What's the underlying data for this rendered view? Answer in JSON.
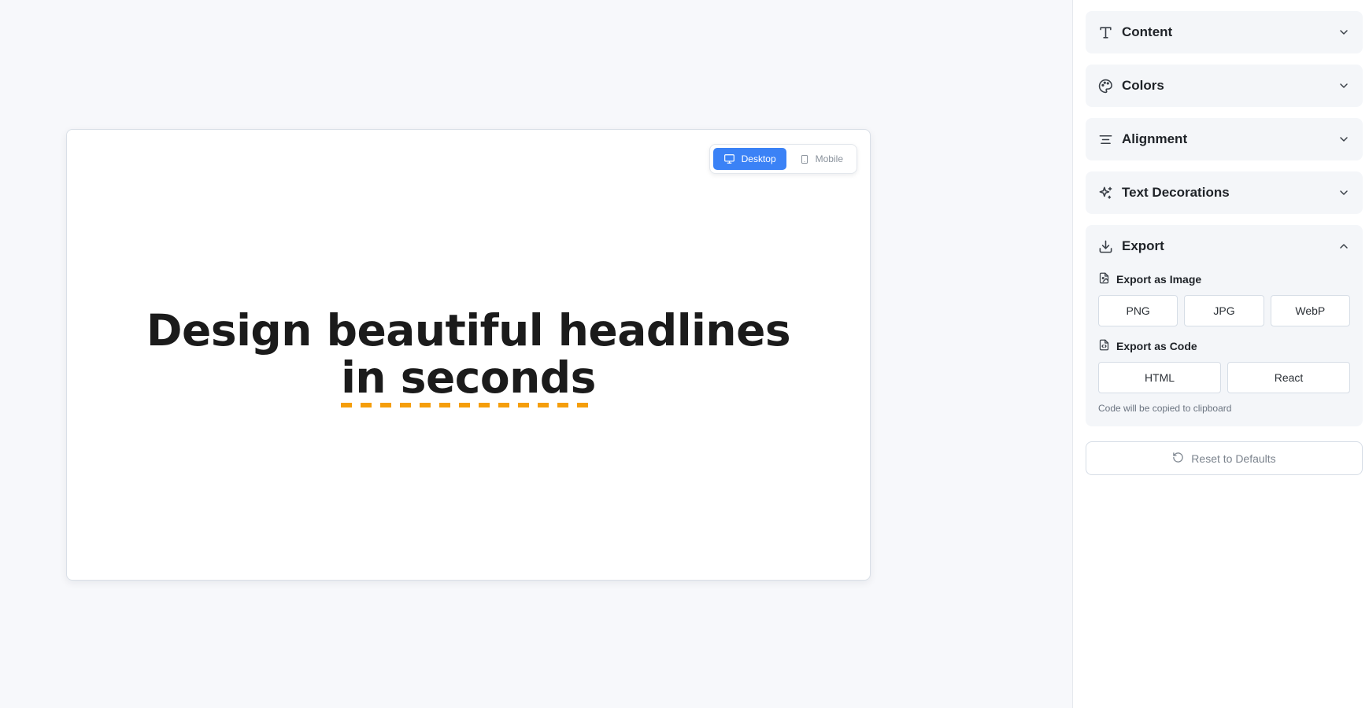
{
  "preview": {
    "view_toggle": {
      "desktop_label": "Desktop",
      "mobile_label": "Mobile",
      "selected": "Desktop"
    },
    "headline": {
      "line1": "Design beautiful headlines",
      "line2": "in seconds"
    },
    "decoration": {
      "style": "dashed underline",
      "color": "#f59e0b"
    }
  },
  "sidebar": {
    "panels": [
      {
        "title": "Content",
        "icon": "type-icon",
        "expanded": false
      },
      {
        "title": "Colors",
        "icon": "palette-icon",
        "expanded": false
      },
      {
        "title": "Alignment",
        "icon": "align-center-icon",
        "expanded": false
      },
      {
        "title": "Text Decorations",
        "icon": "sparkles-icon",
        "expanded": false
      },
      {
        "title": "Export",
        "icon": "download-icon",
        "expanded": true
      }
    ],
    "export": {
      "image_heading": "Export as Image",
      "image_formats": [
        "PNG",
        "JPG",
        "WebP"
      ],
      "code_heading": "Export as Code",
      "code_formats": [
        "HTML",
        "React"
      ],
      "hint": "Code will be copied to clipboard"
    },
    "reset_label": "Reset to Defaults"
  },
  "colors": {
    "accent": "#3b82f6",
    "decoration": "#f59e0b",
    "text": "#1b1b1b"
  }
}
